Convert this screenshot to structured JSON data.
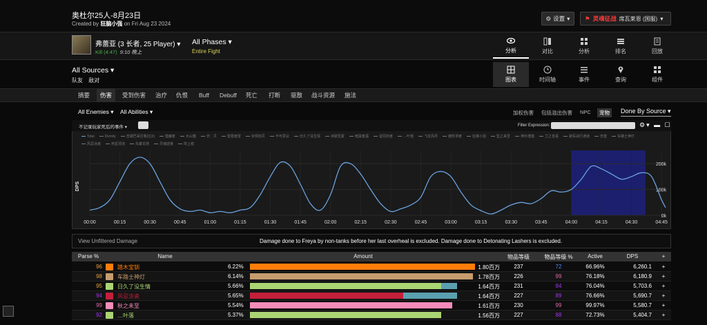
{
  "header": {
    "title": "奥杜尔25人-8月23日",
    "created_prefix": "Created by",
    "author": "狂脑小强",
    "created_suffix": "on Fri Aug 23 2024",
    "settings_label": "设置",
    "realm_name": "灵魂征战",
    "realm_server": "席瓦莱恩 (国服)"
  },
  "fight": {
    "boss_name": "弗蕾亚 (3 长者, 25 Player)",
    "kill_text": "Kill (4:47)",
    "kill_time": "9:10 晚上",
    "phases_label": "All Phases",
    "phase_sub": "Entire Fight"
  },
  "topnav": [
    {
      "label": "分析",
      "icon": "eye-icon",
      "active": true
    },
    {
      "label": "对比",
      "icon": "compare-icon"
    },
    {
      "label": "分析",
      "icon": "analyze-icon"
    },
    {
      "label": "排名",
      "icon": "ranking-icon"
    },
    {
      "label": "回放",
      "icon": "replay-icon"
    }
  ],
  "sources": {
    "title": "All Sources",
    "tab1": "队友",
    "tab2": "敌对"
  },
  "viewnav": [
    {
      "label": "图表",
      "icon": "grid-icon",
      "active": true
    },
    {
      "label": "时间轴",
      "icon": "clock-icon"
    },
    {
      "label": "事件",
      "icon": "list-icon"
    },
    {
      "label": "查询",
      "icon": "pin-icon"
    },
    {
      "label": "组件",
      "icon": "widgets-icon"
    }
  ],
  "tabs": [
    "摘要",
    "伤害",
    "受到伤害",
    "治疗",
    "仇恨",
    "Buff",
    "Debuff",
    "死亡",
    "打断",
    "驱散",
    "战斗资源",
    "施法"
  ],
  "active_tab": "伤害",
  "filters": {
    "enemies": "All Enemies",
    "abilities": "All Abilities",
    "right": [
      "加权伤害",
      "包括溢出伤害",
      "NPC",
      "宠物"
    ],
    "right_active": "宠物",
    "done_by": "Done By Source"
  },
  "graph": {
    "select_label": "不记录玩家死后的事件",
    "filter_label": "Filter Expression:",
    "tools": "⚙▾ ▬ ☐",
    "legend": [
      "Total",
      "Divinity",
      "吉姆巴哥巨鲁拉(3)",
      "猎魔者",
      "大山猫",
      "天：贝",
      "雷霆者雷",
      "宗师加贝",
      "不可思议",
      "日久了没生情",
      "诗歌至蒙",
      "暗黑蜜语",
      "诅咒的者",
      "…叶落",
      "飞龙风月",
      "傲所求者",
      "狂暴小强",
      "坠之来至",
      "神外潜猎",
      "兰之皆喜",
      "破军战行通道",
      "伤害",
      "车路士神灯",
      "风忌涂瓷",
      "死星漂流",
      "先秦龙骑",
      "灵魂逆袭",
      "阵上痕"
    ],
    "legend_colors": [
      "#6aa3e0",
      "#777",
      "#777",
      "#777",
      "#777",
      "#777",
      "#777",
      "#777",
      "#777",
      "#777",
      "#777",
      "#777",
      "#777",
      "#777",
      "#777",
      "#777",
      "#777",
      "#777",
      "#777",
      "#777",
      "#777",
      "#777",
      "#777",
      "#777",
      "#777",
      "#777",
      "#777",
      "#777"
    ]
  },
  "chart_data": {
    "type": "line",
    "ylabel": "DPS",
    "x_ticks": [
      "00:00",
      "00:15",
      "00:30",
      "00:45",
      "01:00",
      "01:15",
      "01:30",
      "01:45",
      "02:00",
      "02:15",
      "02:30",
      "02:45",
      "03:00",
      "03:15",
      "03:30",
      "03:45",
      "04:00",
      "04:15",
      "04:30",
      "04:45"
    ],
    "y_ticks": [
      "0k",
      "100k",
      "200k"
    ],
    "ylim": [
      0,
      230000
    ],
    "xlim": [
      0,
      287
    ],
    "highlight_range": [
      240,
      277
    ],
    "series": [
      {
        "name": "Total",
        "color": "#6aa3e0",
        "x": [
          0,
          5,
          10,
          15,
          20,
          25,
          30,
          35,
          40,
          45,
          50,
          55,
          60,
          65,
          70,
          75,
          80,
          85,
          90,
          95,
          100,
          105,
          110,
          115,
          120,
          125,
          130,
          135,
          140,
          145,
          150,
          155,
          160,
          165,
          170,
          175,
          180,
          185,
          190,
          195,
          200,
          205,
          210,
          215,
          220,
          225,
          230,
          235,
          240,
          245,
          250,
          255,
          260,
          265,
          270,
          275,
          280,
          285,
          287
        ],
        "y": [
          20000,
          30000,
          60000,
          130000,
          200000,
          225000,
          200000,
          130000,
          60000,
          25000,
          15000,
          20000,
          10000,
          15000,
          10000,
          20000,
          30000,
          80000,
          150000,
          205000,
          190000,
          120000,
          45000,
          20000,
          80000,
          190000,
          200000,
          160000,
          100000,
          45000,
          15000,
          25000,
          40000,
          70000,
          150000,
          170000,
          150000,
          90000,
          40000,
          18000,
          5000,
          20000,
          40000,
          50000,
          45000,
          65000,
          95000,
          90000,
          100000,
          140000,
          190000,
          180000,
          160000,
          140000,
          150000,
          165000,
          150000,
          60000,
          30000
        ]
      }
    ]
  },
  "note": {
    "left": "View Unfiltered Damage",
    "right": "Damage done to Freya by non-tanks before her last overheal is excluded. Damage done to Detonating Lashers is excluded."
  },
  "table": {
    "headers": [
      "Parse %",
      "Name",
      "Amount",
      "物品等级",
      "物品等级 %",
      "Active",
      "DPS",
      "+"
    ],
    "rows": [
      {
        "parse": "96",
        "parse_color": "#e6a23c",
        "name": "踏木宝钏",
        "name_color": "#ff7d0a",
        "pct": "6.22%",
        "amount": "1.80百万",
        "bar_color": "#ff7d0a",
        "bar_frac": 1.0,
        "bar2_frac": 0,
        "ilvl": "237",
        "ilvl_pct": "72",
        "ilvl_pct_color": "#5588ff",
        "active": "66.96%",
        "dps": "6,260.1"
      },
      {
        "parse": "98",
        "parse_color": "#e6a23c",
        "name": "车路士神灯",
        "name_color": "#c79c6e",
        "pct": "6.14%",
        "amount": "1.78百万",
        "bar_color": "#c79c6e",
        "bar_frac": 0.99,
        "bar2_frac": 0,
        "ilvl": "226",
        "ilvl_pct": "99",
        "ilvl_pct_color": "#e268a8",
        "active": "76.18%",
        "dps": "6,180.9"
      },
      {
        "parse": "95",
        "parse_color": "#e6a23c",
        "name": "日久了没生情",
        "name_color": "#abd473",
        "pct": "5.66%",
        "amount": "1.64百万",
        "bar_color": "#abd473",
        "bar_frac": 0.85,
        "bar2_frac": 0.07,
        "ilvl": "231",
        "ilvl_pct": "84",
        "ilvl_pct_color": "#a335ee",
        "active": "76.04%",
        "dps": "5,703.6"
      },
      {
        "parse": "94",
        "parse_color": "#a335ee",
        "name": "风忌涂瓷",
        "name_color": "#c41f3b",
        "pct": "5.65%",
        "amount": "1.64百万",
        "bar_color": "#c41f3b",
        "bar_frac": 0.68,
        "bar2_frac": 0.24,
        "ilvl": "227",
        "ilvl_pct": "89",
        "ilvl_pct_color": "#a335ee",
        "active": "76.66%",
        "dps": "5,690.7"
      },
      {
        "parse": "99",
        "parse_color": "#e268a8",
        "name": "秋之未至",
        "name_color": "#f58cba",
        "pct": "5.54%",
        "amount": "1.61百万",
        "bar_color": "#f58cba",
        "bar_frac": 0.9,
        "bar2_frac": 0,
        "ilvl": "230",
        "ilvl_pct": "99",
        "ilvl_pct_color": "#e268a8",
        "active": "99.97%",
        "dps": "5,580.7"
      },
      {
        "parse": "92",
        "parse_color": "#a335ee",
        "name": "…叶落",
        "name_color": "#abd473",
        "pct": "5.37%",
        "amount": "1.56百万",
        "bar_color": "#abd473",
        "bar_frac": 0.85,
        "bar2_frac": 0,
        "ilvl": "227",
        "ilvl_pct": "88",
        "ilvl_pct_color": "#a335ee",
        "active": "72.73%",
        "dps": "5,404.7"
      }
    ]
  }
}
